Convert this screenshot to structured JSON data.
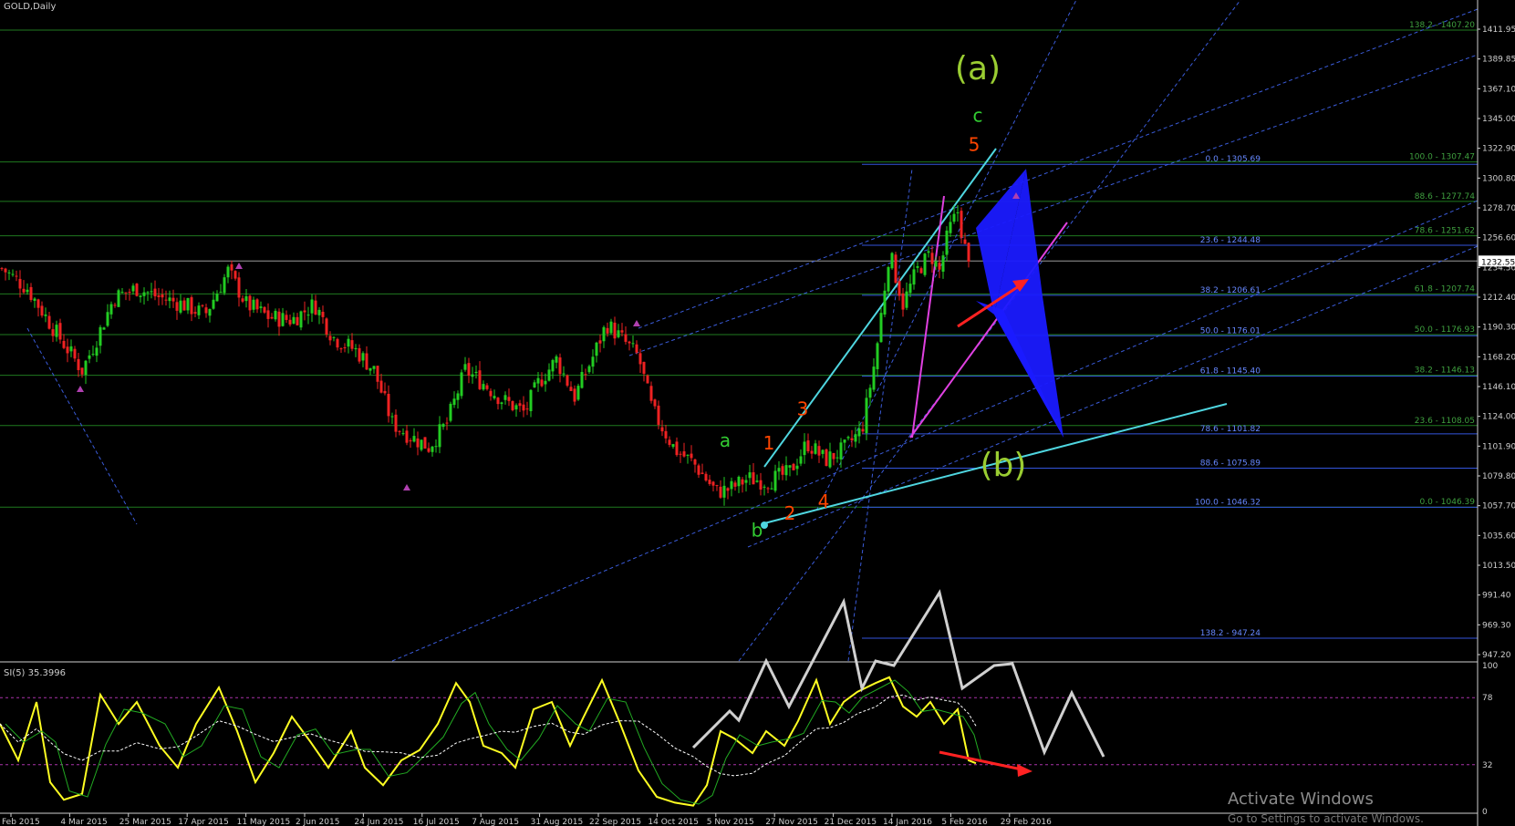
{
  "chart_data": {
    "type": "candlestick",
    "symbol": "GOLD,Daily",
    "main_ylim": [
      930,
      1430
    ],
    "price_axis_labels": [
      "1411.95",
      "1389.85",
      "1367.10",
      "1345.00",
      "1322.90",
      "1300.80",
      "1278.70",
      "1256.60",
      "1234.50",
      "1212.40",
      "1190.30",
      "1168.20",
      "1146.10",
      "1124.00",
      "1101.90",
      "1079.80",
      "1057.70",
      "1035.60",
      "1013.50",
      "991.40",
      "969.30",
      "947.20"
    ],
    "current_price": "1232.55",
    "date_labels": [
      "Feb 2015",
      "4 Mar 2015",
      "25 Mar 2015",
      "17 Apr 2015",
      "11 May 2015",
      "2 Jun 2015",
      "24 Jun 2015",
      "16 Jul 2015",
      "7 Aug 2015",
      "31 Aug 2015",
      "22 Sep 2015",
      "14 Oct 2015",
      "5 Nov 2015",
      "27 Nov 2015",
      "21 Dec 2015",
      "14 Jan 2016",
      "5 Feb 2016",
      "29 Feb 2016"
    ],
    "price_path": [
      [
        0,
        1228
      ],
      [
        30,
        1212
      ],
      [
        60,
        1180
      ],
      [
        90,
        1150
      ],
      [
        105,
        1172
      ],
      [
        125,
        1205
      ],
      [
        150,
        1212
      ],
      [
        175,
        1205
      ],
      [
        200,
        1200
      ],
      [
        225,
        1192
      ],
      [
        250,
        1225
      ],
      [
        270,
        1200
      ],
      [
        295,
        1190
      ],
      [
        320,
        1188
      ],
      [
        345,
        1200
      ],
      [
        365,
        1175
      ],
      [
        390,
        1165
      ],
      [
        410,
        1150
      ],
      [
        430,
        1110
      ],
      [
        450,
        1100
      ],
      [
        470,
        1092
      ],
      [
        490,
        1110
      ],
      [
        510,
        1150
      ],
      [
        530,
        1140
      ],
      [
        550,
        1128
      ],
      [
        575,
        1118
      ],
      [
        590,
        1140
      ],
      [
        610,
        1158
      ],
      [
        630,
        1130
      ],
      [
        650,
        1160
      ],
      [
        665,
        1185
      ],
      [
        680,
        1175
      ],
      [
        700,
        1160
      ],
      [
        715,
        1120
      ],
      [
        740,
        1090
      ],
      [
        760,
        1080
      ],
      [
        785,
        1058
      ],
      [
        800,
        1060
      ],
      [
        820,
        1068
      ],
      [
        840,
        1066
      ],
      [
        865,
        1072
      ],
      [
        885,
        1095
      ],
      [
        905,
        1082
      ],
      [
        925,
        1090
      ],
      [
        945,
        1105
      ],
      [
        960,
        1160
      ],
      [
        975,
        1240
      ],
      [
        990,
        1200
      ],
      [
        1005,
        1225
      ],
      [
        1020,
        1238
      ],
      [
        1030,
        1225
      ],
      [
        1040,
        1255
      ],
      [
        1050,
        1270
      ],
      [
        1062,
        1228
      ]
    ],
    "fib_right": [
      {
        "label": "138.2 - 1407.20",
        "value": 1407.2
      },
      {
        "label": "100.0 - 1307.47",
        "value": 1307.5
      },
      {
        "label": "88.6 - 1277.74",
        "value": 1277.7
      },
      {
        "label": "78.6 - 1251.62",
        "value": 1251.6
      },
      {
        "label": "61.8 - 1207.74",
        "value": 1207.7
      },
      {
        "label": "50.0 - 1176.93",
        "value": 1176.9
      },
      {
        "label": "38.2 - 1146.13",
        "value": 1146.1
      },
      {
        "label": "23.6 - 1108.05",
        "value": 1108.1
      },
      {
        "label": "0.0 - 1046.39",
        "value": 1046.4
      }
    ],
    "fib_mid": [
      {
        "label": "0.0 - 1305.69",
        "value": 1305.7
      },
      {
        "label": "23.6 - 1244.48",
        "value": 1244.5
      },
      {
        "label": "38.2 - 1206.61",
        "value": 1206.6
      },
      {
        "label": "50.0 - 1176.01",
        "value": 1176.0
      },
      {
        "label": "61.8 - 1145.40",
        "value": 1145.4
      },
      {
        "label": "78.6 - 1101.82",
        "value": 1101.8
      },
      {
        "label": "88.6 - 1075.89",
        "value": 1075.9
      },
      {
        "label": "100.0 - 1046.32",
        "value": 1046.3
      },
      {
        "label": "138.2 - 947.24",
        "value": 947.2
      }
    ],
    "wave_labels": [
      {
        "text": "(a)",
        "color": "#9acd32",
        "x": 1072,
        "price": 1370
      },
      {
        "text": "c",
        "color": "#32cd32",
        "x": 1072,
        "price": 1338
      },
      {
        "text": "5",
        "color": "#ff4500",
        "x": 1068,
        "price": 1316
      },
      {
        "text": "a",
        "color": "#32cd32",
        "x": 795,
        "price": 1092
      },
      {
        "text": "b",
        "color": "#32cd32",
        "x": 830,
        "price": 1024
      },
      {
        "text": "1",
        "color": "#ff4500",
        "x": 843,
        "price": 1090
      },
      {
        "text": "2",
        "color": "#ff4500",
        "x": 866,
        "price": 1037
      },
      {
        "text": "3",
        "color": "#ff4500",
        "x": 880,
        "price": 1116
      },
      {
        "text": "4",
        "color": "#ff4500",
        "x": 903,
        "price": 1046
      },
      {
        "text": "(b)",
        "color": "#9acd32",
        "x": 1100,
        "price": 1070
      }
    ],
    "oscillator": {
      "label": "SI(5) 35.3996",
      "ylim": [
        0,
        100
      ],
      "levels": [
        78,
        32
      ],
      "axis_labels": [
        "100",
        "78",
        "32",
        "0"
      ],
      "yellow": [
        [
          0,
          60
        ],
        [
          20,
          35
        ],
        [
          40,
          75
        ],
        [
          55,
          20
        ],
        [
          70,
          8
        ],
        [
          90,
          12
        ],
        [
          110,
          80
        ],
        [
          130,
          60
        ],
        [
          150,
          75
        ],
        [
          175,
          45
        ],
        [
          195,
          30
        ],
        [
          215,
          60
        ],
        [
          240,
          85
        ],
        [
          260,
          55
        ],
        [
          280,
          20
        ],
        [
          300,
          40
        ],
        [
          320,
          65
        ],
        [
          340,
          48
        ],
        [
          360,
          30
        ],
        [
          385,
          55
        ],
        [
          400,
          30
        ],
        [
          420,
          18
        ],
        [
          440,
          35
        ],
        [
          460,
          42
        ],
        [
          480,
          60
        ],
        [
          500,
          88
        ],
        [
          515,
          75
        ],
        [
          530,
          45
        ],
        [
          550,
          40
        ],
        [
          565,
          30
        ],
        [
          585,
          70
        ],
        [
          605,
          75
        ],
        [
          625,
          45
        ],
        [
          640,
          65
        ],
        [
          660,
          90
        ],
        [
          680,
          60
        ],
        [
          700,
          28
        ],
        [
          720,
          10
        ],
        [
          740,
          6
        ],
        [
          760,
          4
        ],
        [
          775,
          18
        ],
        [
          790,
          55
        ],
        [
          805,
          50
        ],
        [
          825,
          40
        ],
        [
          840,
          55
        ],
        [
          860,
          45
        ],
        [
          875,
          62
        ],
        [
          895,
          90
        ],
        [
          910,
          60
        ],
        [
          925,
          75
        ],
        [
          940,
          82
        ],
        [
          960,
          88
        ],
        [
          975,
          92
        ],
        [
          990,
          72
        ],
        [
          1005,
          65
        ],
        [
          1020,
          75
        ],
        [
          1035,
          60
        ],
        [
          1050,
          70
        ],
        [
          1062,
          35
        ],
        [
          1070,
          33
        ]
      ],
      "white": [
        [
          765,
          72
        ],
        [
          780,
          80
        ],
        [
          800,
          90
        ],
        [
          815,
          80
        ],
        [
          828,
          70
        ],
        [
          843,
          88
        ],
        [
          858,
          100
        ],
        [
          873,
          82
        ],
        [
          890,
          62
        ],
        [
          905,
          88
        ],
        [
          920,
          92
        ],
        [
          935,
          78
        ],
        [
          950,
          96
        ],
        [
          965,
          88
        ],
        [
          980,
          110
        ],
        [
          995,
          100
        ],
        [
          1010,
          90
        ],
        [
          1025,
          92
        ],
        [
          1040,
          96
        ],
        [
          1055,
          80
        ],
        [
          1070,
          62
        ]
      ]
    },
    "watermark_title": "Activate Windows",
    "watermark_sub": "Go to Settings to activate Windows."
  }
}
